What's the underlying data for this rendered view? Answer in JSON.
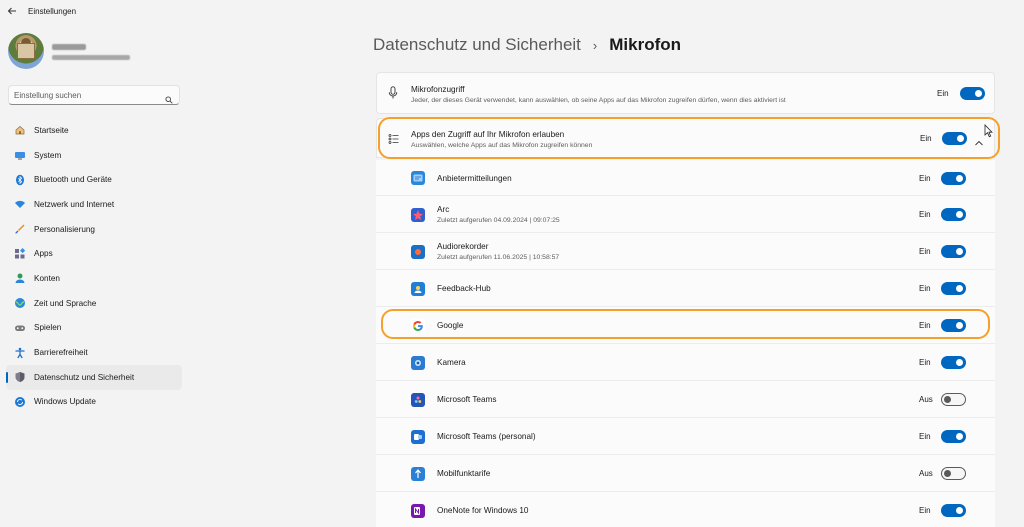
{
  "window": {
    "title": "Einstellungen"
  },
  "search": {
    "placeholder": "Einstellung suchen"
  },
  "nav": [
    {
      "label": "Startseite",
      "icon": "home-icon",
      "active": false
    },
    {
      "label": "System",
      "icon": "system-icon",
      "active": false
    },
    {
      "label": "Bluetooth und Geräte",
      "icon": "bluetooth-icon",
      "active": false
    },
    {
      "label": "Netzwerk und Internet",
      "icon": "network-icon",
      "active": false
    },
    {
      "label": "Personalisierung",
      "icon": "brush-icon",
      "active": false
    },
    {
      "label": "Apps",
      "icon": "apps-icon",
      "active": false
    },
    {
      "label": "Konten",
      "icon": "account-icon",
      "active": false
    },
    {
      "label": "Zeit und Sprache",
      "icon": "globe-clock-icon",
      "active": false
    },
    {
      "label": "Spielen",
      "icon": "gamepad-icon",
      "active": false
    },
    {
      "label": "Barrierefreiheit",
      "icon": "accessibility-icon",
      "active": false
    },
    {
      "label": "Datenschutz und Sicherheit",
      "icon": "shield-icon",
      "active": true
    },
    {
      "label": "Windows Update",
      "icon": "update-icon",
      "active": false
    }
  ],
  "header": {
    "parent": "Datenschutz und Sicherheit",
    "separator": "›",
    "current": "Mikrofon"
  },
  "mic_access": {
    "title": "Mikrofonzugriff",
    "subtitle": "Jeder, der dieses Gerät verwendet, kann auswählen, ob seine Apps auf das Mikrofon zugreifen dürfen, wenn dies aktiviert ist",
    "state": "Ein",
    "on": true
  },
  "apps_access": {
    "title": "Apps den Zugriff auf Ihr Mikrofon erlauben",
    "subtitle": "Auswählen, welche Apps auf das Mikrofon zugreifen können",
    "state": "Ein",
    "on": true
  },
  "apps": [
    {
      "name": "Anbietermitteilungen",
      "sub": "",
      "state": "Ein",
      "on": true,
      "icon": "provider-notifications-icon",
      "color": "#2b88d8"
    },
    {
      "name": "Arc",
      "sub": "Zuletzt aufgerufen 04.09.2024  |  09:07:25",
      "state": "Ein",
      "on": true,
      "icon": "arc-icon",
      "color": "#2f5fd0"
    },
    {
      "name": "Audiorekorder",
      "sub": "Zuletzt aufgerufen 11.06.2025  |  10:58:57",
      "state": "Ein",
      "on": true,
      "icon": "recorder-icon",
      "color": "#1b6fc4"
    },
    {
      "name": "Feedback-Hub",
      "sub": "",
      "state": "Ein",
      "on": true,
      "icon": "feedback-hub-icon",
      "color": "#1f7fd6"
    },
    {
      "name": "Google",
      "sub": "",
      "state": "Ein",
      "on": true,
      "icon": "google-icon",
      "color": "#ffffff"
    },
    {
      "name": "Kamera",
      "sub": "",
      "state": "Ein",
      "on": true,
      "icon": "camera-icon",
      "color": "#2b7bd0"
    },
    {
      "name": "Microsoft Teams",
      "sub": "",
      "state": "Aus",
      "on": false,
      "icon": "teams-icon",
      "color": "#2456b8"
    },
    {
      "name": "Microsoft Teams (personal)",
      "sub": "",
      "state": "Ein",
      "on": true,
      "icon": "teams-personal-icon",
      "color": "#1f6fd0"
    },
    {
      "name": "Mobilfunktarife",
      "sub": "",
      "state": "Aus",
      "on": false,
      "icon": "mobile-plans-icon",
      "color": "#2a80d6"
    },
    {
      "name": "OneNote for Windows 10",
      "sub": "",
      "state": "Ein",
      "on": true,
      "icon": "onenote-icon",
      "color": "#7719aa"
    }
  ],
  "colors": {
    "accent": "#0067c0",
    "highlight": "#f5a02a"
  }
}
